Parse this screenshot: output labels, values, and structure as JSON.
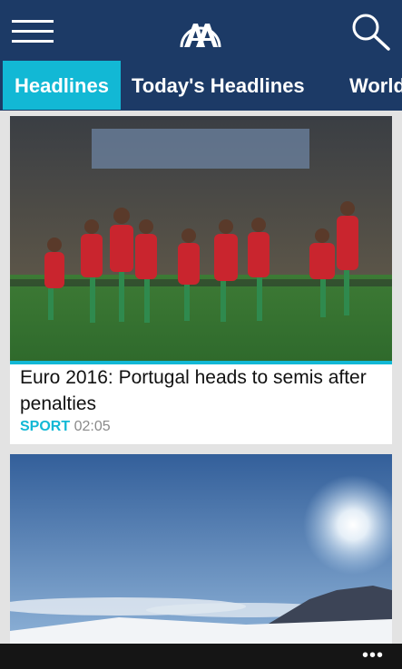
{
  "header": {
    "menu_icon": "hamburger-menu-icon",
    "logo_icon": "anadolu-agency-logo",
    "search_icon": "search-icon",
    "background": "#1c3a66"
  },
  "tabs": [
    {
      "label": "Headlines",
      "active": true
    },
    {
      "label": "Today's Headlines",
      "active": false
    },
    {
      "label": "World",
      "active": false
    }
  ],
  "accent_color": "#12b8d5",
  "feed": [
    {
      "headline": "Euro 2016: Portugal heads to semis after penalties",
      "category": "SPORT",
      "time": "02:05",
      "image": "football-team-celebration-photo"
    },
    {
      "image": "snowy-landscape-sun-photo"
    }
  ],
  "appbar": {
    "more_label": "•••"
  }
}
